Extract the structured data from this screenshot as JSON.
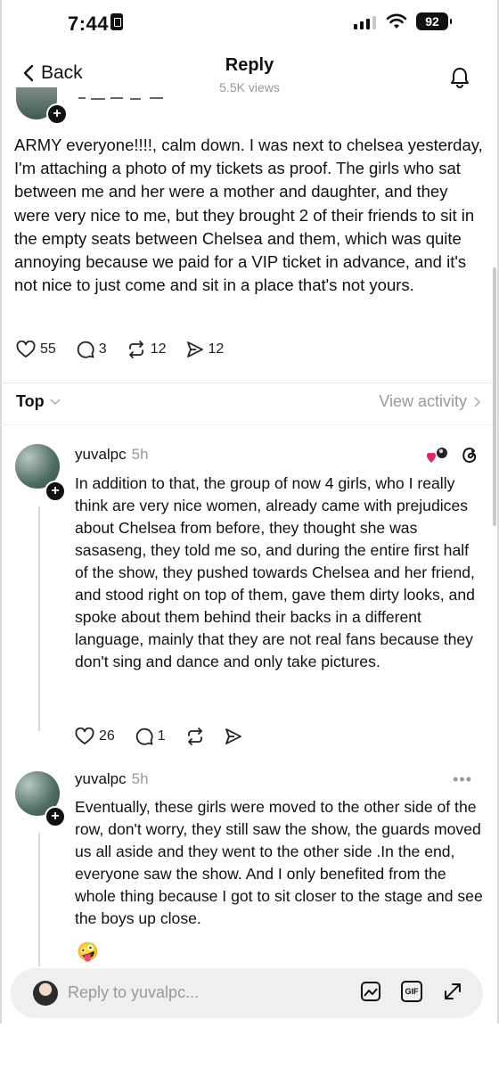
{
  "status_bar": {
    "time": "7:44",
    "battery": "92"
  },
  "header": {
    "back_label": "Back",
    "title": "Reply",
    "views": "5.5K views"
  },
  "original_post": {
    "text": "ARMY everyone!!!!, calm down. I was next to chelsea yesterday, I'm attaching a photo of my tickets as proof. The girls who sat between me and her were a mother and daughter, and they were very nice to me, but they brought 2 of their friends to sit in the empty seats between Chelsea and them, which was quite annoying because we paid for a VIP ticket in advance, and it's not nice to just come and sit in a place that's not yours.",
    "likes": "55",
    "comments": "3",
    "reposts": "12",
    "shares": "12"
  },
  "sort": {
    "label": "Top",
    "view_activity": "View activity"
  },
  "replies": [
    {
      "username": "yuvalpc",
      "time": "5h",
      "text": "In addition to that, the group of now 4 girls, who I really think are very nice women, already came with prejudices about Chelsea from before, they thought she was sasaseng, they told me so, and during the entire first half of the show, they pushed towards Chelsea and her friend, and stood right on top of them, gave them dirty looks, and spoke about them behind their backs in a different language, mainly that they are not real fans because they don't sing and dance and only take pictures.",
      "likes": "26",
      "comments": "1"
    },
    {
      "username": "yuvalpc",
      "time": "5h",
      "text": "Eventually, these girls were moved to the other side of the row, don't worry, they still saw the show, the guards moved us all aside and they went to the other side .In the end, everyone saw the show.  And I only benefited from the whole thing because I got to sit closer to the stage and see the boys up close.",
      "emoji": "🤪",
      "more": "•••"
    }
  ],
  "composer": {
    "placeholder": "Reply to yuvalpc..."
  },
  "icons": {
    "back": "chevron-left-icon",
    "bell": "bell-icon",
    "like": "heart-icon",
    "comment": "comment-icon",
    "repost": "repost-icon",
    "share": "share-icon",
    "threads": "threads-icon",
    "image": "image-icon",
    "gif": "gif-icon",
    "expand": "expand-icon"
  },
  "colors": {
    "accent_badge": "#e0245e",
    "muted": "#999999"
  }
}
